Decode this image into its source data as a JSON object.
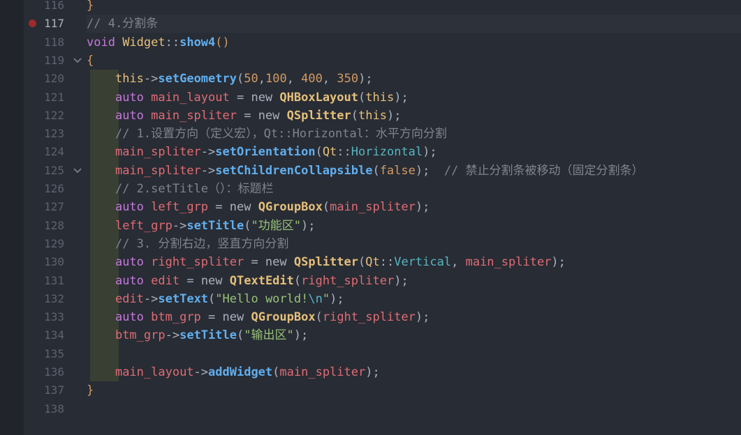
{
  "editor": {
    "active_line": "117",
    "breakpoint_line": "117",
    "lines": [
      {
        "n": "116",
        "tokens": [
          {
            "t": "}",
            "c": "brace"
          }
        ]
      },
      {
        "n": "117",
        "tokens": [
          {
            "t": "// 4.分割条",
            "c": "com"
          }
        ]
      },
      {
        "n": "118",
        "tokens": [
          {
            "t": "void ",
            "c": "kw"
          },
          {
            "t": "Widget",
            "c": "class"
          },
          {
            "t": "::",
            "c": "op"
          },
          {
            "t": "show4",
            "c": "fn"
          },
          {
            "t": "()",
            "c": "brace"
          }
        ]
      },
      {
        "n": "119",
        "tokens": [
          {
            "t": "{",
            "c": "brace"
          }
        ]
      },
      {
        "n": "120",
        "tokens": [
          {
            "t": "    "
          },
          {
            "t": "this",
            "c": "this"
          },
          {
            "t": "->",
            "c": "op"
          },
          {
            "t": "setGeometry",
            "c": "fn"
          },
          {
            "t": "(",
            "c": "op"
          },
          {
            "t": "50",
            "c": "num"
          },
          {
            "t": ",",
            "c": "op"
          },
          {
            "t": "100",
            "c": "num"
          },
          {
            "t": ", ",
            "c": "op"
          },
          {
            "t": "400",
            "c": "num"
          },
          {
            "t": ", ",
            "c": "op"
          },
          {
            "t": "350",
            "c": "num"
          },
          {
            "t": ");",
            "c": "op"
          }
        ]
      },
      {
        "n": "121",
        "tokens": [
          {
            "t": "    "
          },
          {
            "t": "auto ",
            "c": "kw"
          },
          {
            "t": "main_layout",
            "c": "var"
          },
          {
            "t": " = ",
            "c": "op"
          },
          {
            "t": "new ",
            "c": "op"
          },
          {
            "t": "QHBoxLayout",
            "c": "type"
          },
          {
            "t": "(",
            "c": "op"
          },
          {
            "t": "this",
            "c": "this"
          },
          {
            "t": ");",
            "c": "op"
          }
        ]
      },
      {
        "n": "122",
        "tokens": [
          {
            "t": "    "
          },
          {
            "t": "auto ",
            "c": "kw"
          },
          {
            "t": "main_spliter",
            "c": "var"
          },
          {
            "t": " = ",
            "c": "op"
          },
          {
            "t": "new ",
            "c": "op"
          },
          {
            "t": "QSplitter",
            "c": "type"
          },
          {
            "t": "(",
            "c": "op"
          },
          {
            "t": "this",
            "c": "this"
          },
          {
            "t": ");",
            "c": "op"
          }
        ]
      },
      {
        "n": "123",
        "tokens": [
          {
            "t": "    "
          },
          {
            "t": "// 1.设置方向（定义宏），Qt::Horizontal：水平方向分割",
            "c": "com"
          }
        ]
      },
      {
        "n": "124",
        "tokens": [
          {
            "t": "    "
          },
          {
            "t": "main_spliter",
            "c": "var"
          },
          {
            "t": "->",
            "c": "op"
          },
          {
            "t": "setOrientation",
            "c": "fn"
          },
          {
            "t": "(",
            "c": "op"
          },
          {
            "t": "Qt",
            "c": "class"
          },
          {
            "t": "::",
            "c": "op"
          },
          {
            "t": "Horizontal",
            "c": "enum"
          },
          {
            "t": ");",
            "c": "op"
          }
        ]
      },
      {
        "n": "125",
        "tokens": [
          {
            "t": "    "
          },
          {
            "t": "main_spliter",
            "c": "var"
          },
          {
            "t": "->",
            "c": "op"
          },
          {
            "t": "setChildrenCollapsible",
            "c": "fn"
          },
          {
            "t": "(",
            "c": "op"
          },
          {
            "t": "false",
            "c": "num"
          },
          {
            "t": ");  ",
            "c": "op"
          },
          {
            "t": "// 禁止分割条被移动（固定分割条）",
            "c": "com"
          }
        ]
      },
      {
        "n": "126",
        "tokens": [
          {
            "t": "    "
          },
          {
            "t": "// 2.setTitle（）：标题栏",
            "c": "com"
          }
        ]
      },
      {
        "n": "127",
        "tokens": [
          {
            "t": "    "
          },
          {
            "t": "auto ",
            "c": "kw"
          },
          {
            "t": "left_grp",
            "c": "var"
          },
          {
            "t": " = ",
            "c": "op"
          },
          {
            "t": "new ",
            "c": "op"
          },
          {
            "t": "QGroupBox",
            "c": "type"
          },
          {
            "t": "(",
            "c": "op"
          },
          {
            "t": "main_spliter",
            "c": "var"
          },
          {
            "t": ");",
            "c": "op"
          }
        ]
      },
      {
        "n": "128",
        "tokens": [
          {
            "t": "    "
          },
          {
            "t": "left_grp",
            "c": "var"
          },
          {
            "t": "->",
            "c": "op"
          },
          {
            "t": "setTitle",
            "c": "fn"
          },
          {
            "t": "(",
            "c": "op"
          },
          {
            "t": "\"功能区\"",
            "c": "str"
          },
          {
            "t": ");",
            "c": "op"
          }
        ]
      },
      {
        "n": "129",
        "tokens": [
          {
            "t": "    "
          },
          {
            "t": "// 3. 分割右边，竖直方向分割",
            "c": "com"
          }
        ]
      },
      {
        "n": "130",
        "tokens": [
          {
            "t": "    "
          },
          {
            "t": "auto ",
            "c": "kw"
          },
          {
            "t": "right_spliter",
            "c": "var"
          },
          {
            "t": " = ",
            "c": "op"
          },
          {
            "t": "new ",
            "c": "op"
          },
          {
            "t": "QSplitter",
            "c": "type"
          },
          {
            "t": "(",
            "c": "op"
          },
          {
            "t": "Qt",
            "c": "class"
          },
          {
            "t": "::",
            "c": "op"
          },
          {
            "t": "Vertical",
            "c": "enum"
          },
          {
            "t": ", ",
            "c": "op"
          },
          {
            "t": "main_spliter",
            "c": "var"
          },
          {
            "t": ");",
            "c": "op"
          }
        ]
      },
      {
        "n": "131",
        "tokens": [
          {
            "t": "    "
          },
          {
            "t": "auto ",
            "c": "kw"
          },
          {
            "t": "edit",
            "c": "var"
          },
          {
            "t": " = ",
            "c": "op"
          },
          {
            "t": "new ",
            "c": "op"
          },
          {
            "t": "QTextEdit",
            "c": "type"
          },
          {
            "t": "(",
            "c": "op"
          },
          {
            "t": "right_spliter",
            "c": "var"
          },
          {
            "t": ");",
            "c": "op"
          }
        ]
      },
      {
        "n": "132",
        "tokens": [
          {
            "t": "    "
          },
          {
            "t": "edit",
            "c": "var"
          },
          {
            "t": "->",
            "c": "op"
          },
          {
            "t": "setText",
            "c": "fn"
          },
          {
            "t": "(",
            "c": "op"
          },
          {
            "t": "\"Hello world!",
            "c": "str"
          },
          {
            "t": "\\n",
            "c": "esc"
          },
          {
            "t": "\"",
            "c": "str"
          },
          {
            "t": ");",
            "c": "op"
          }
        ]
      },
      {
        "n": "133",
        "tokens": [
          {
            "t": "    "
          },
          {
            "t": "auto ",
            "c": "kw"
          },
          {
            "t": "btm_grp",
            "c": "var"
          },
          {
            "t": " = ",
            "c": "op"
          },
          {
            "t": "new ",
            "c": "op"
          },
          {
            "t": "QGroupBox",
            "c": "type"
          },
          {
            "t": "(",
            "c": "op"
          },
          {
            "t": "right_spliter",
            "c": "var"
          },
          {
            "t": ");",
            "c": "op"
          }
        ]
      },
      {
        "n": "134",
        "tokens": [
          {
            "t": "    "
          },
          {
            "t": "btm_grp",
            "c": "var"
          },
          {
            "t": "->",
            "c": "op"
          },
          {
            "t": "setTitle",
            "c": "fn"
          },
          {
            "t": "(",
            "c": "op"
          },
          {
            "t": "\"输出区\"",
            "c": "str"
          },
          {
            "t": ");",
            "c": "op"
          }
        ]
      },
      {
        "n": "135",
        "tokens": []
      },
      {
        "n": "136",
        "tokens": [
          {
            "t": "    "
          },
          {
            "t": "main_layout",
            "c": "var"
          },
          {
            "t": "->",
            "c": "op"
          },
          {
            "t": "addWidget",
            "c": "fn"
          },
          {
            "t": "(",
            "c": "op"
          },
          {
            "t": "main_spliter",
            "c": "var"
          },
          {
            "t": ");",
            "c": "op"
          }
        ]
      },
      {
        "n": "137",
        "tokens": [
          {
            "t": "}",
            "c": "brace"
          }
        ]
      },
      {
        "n": "138",
        "tokens": []
      }
    ],
    "fold_lines": [
      "119",
      "125"
    ],
    "colors": {
      "background": "#282c34",
      "gutter_strip": "#21252b",
      "breakpoint": "#9e2a2b",
      "indent_guide": "#3a3f33"
    }
  }
}
